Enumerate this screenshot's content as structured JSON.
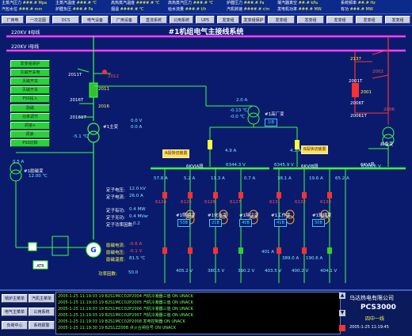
{
  "top_bar": {
    "items": [
      {
        "label": "主蒸汽压力",
        "value": "###.# Mpa"
      },
      {
        "label": "主蒸汽温度",
        "value": "###.# ℃"
      },
      {
        "label": "高热蒸汽温度",
        "value": "####.# ℃"
      },
      {
        "label": "高热蒸汽压力",
        "value": "###.# ℃"
      },
      {
        "label": "炉膛压力",
        "value": "###.# Pa"
      },
      {
        "label": "凝汽器真空",
        "value": "##.# kPa"
      },
      {
        "label": "发电机功率",
        "value": "###.# MW"
      },
      {
        "label": "系统频率",
        "value": "##.# Hz"
      },
      {
        "label": "汽包水位",
        "value": "###.# mm"
      },
      {
        "label": "炉膛负压",
        "value": "###.# Pa"
      },
      {
        "label": "烟温",
        "value": "####.# ℃"
      },
      {
        "label": "给水流量",
        "value": "###.# t/h"
      },
      {
        "label": "汽机转速",
        "value": "####.# r/m"
      },
      {
        "label": "有功",
        "value": "###.# MW"
      }
    ]
  },
  "menu": {
    "items": [
      "厂用电",
      "一次总图",
      "DCS",
      "电气设备",
      "厂用设备",
      "直流系统",
      "公用系统",
      "UPS",
      "发变组",
      "发变组保护",
      "发变组",
      "发变组",
      "发变组",
      "发变组",
      "发变组"
    ]
  },
  "diagram": {
    "title": "#1机组电气主接线系统",
    "bus_ii": "220KV Ⅱ母线",
    "bus_i": "220KV Ⅰ母线",
    "switch_2011T": "2011T",
    "switch_2012": "2012",
    "switch_2011": "2011",
    "switch_2016T": "2016T",
    "switch_2016": "2016",
    "switch_2016_1T": "20161T",
    "switch_2137": "2137",
    "switch_2001T": "2001T",
    "switch_2001": "2001",
    "switch_2002": "2002",
    "switch_2006T": "2006T",
    "switch_2006": "2006",
    "switch_2006_1T": "20061T",
    "qibei": "启备变",
    "main_xfmr": "#1主变",
    "main_xfmr_v": "0.0 V",
    "main_xfmr_a": "0.0 A",
    "main_xfmr_ang": "-5.1 ℃",
    "gao_xfmr": "#1高厂变",
    "gao_v1": "2.0 A",
    "gao_v2": "-0.13 ℃",
    "gao_v3": "-0.0 ℃",
    "gao_tag": "1IB",
    "left_xfmr": "#1励磁变",
    "left_a": "0.5 A",
    "left_b": "12.00 ℃",
    "xfmr_11": "11",
    "xfmr_12": "612",
    "sec_a": "A段快切装置",
    "sec_b": "B段快切装置",
    "bus_6a": "6KVⅠA段",
    "bus_6a_v": "6344.3 V",
    "bus_6b": "6KVⅠB段",
    "bus_6b_v": "6345.9 V",
    "bus_6c": "6KVⅠ段",
    "bus_6c_v": "6366.6 V",
    "i_a": "4.9 A",
    "i_b": "4.2 A",
    "feeders": [
      {
        "a": "57.8 A",
        "name": "6124"
      },
      {
        "a": "5.2 A",
        "name": "6125"
      },
      {
        "a": "11.3 A",
        "name": "6126"
      },
      {
        "a": "0.7 A",
        "name": "6127"
      },
      {
        "a": "38.1 A",
        "name": "6131"
      },
      {
        "a": "19.6 A",
        "name": "6132"
      },
      {
        "a": "65.2 A",
        "name": "6133"
      }
    ],
    "sub_xfmr": [
      {
        "name": "#1照明变",
        "tag": "53B"
      },
      {
        "name": "#1化水变",
        "tag": "21B"
      },
      {
        "name": "#1除尘变",
        "tag": "40B"
      },
      {
        "name": "#1工作变",
        "tag": "41B"
      },
      {
        "name": "#1输煤变",
        "tag": "50B"
      }
    ],
    "low_vals": [
      "405.2 V",
      "380.5 V",
      "390.2 V",
      "403.5 V",
      "400.2 V",
      "404.1 V"
    ],
    "low_a": [
      "401 A",
      "389.0 A",
      "190.6 A"
    ],
    "stator_labels": [
      "定子电压:",
      "定子电流:",
      "定子有功:",
      "定子无功:",
      "定子功率因数:"
    ],
    "stator_vals": [
      "12.0 kV",
      "26.0 A",
      "0.4 MW",
      "0.4 MVar",
      "0.2 "
    ],
    "field_labels": [
      "励磁电流:",
      "励磁电压:",
      "励磁温度:",
      "功率因数:"
    ],
    "field_vals": [
      "-0.6 A",
      "-0.1 V",
      "81.5 ℃",
      "50.0"
    ],
    "gen_label": "G",
    "atr": "ATR",
    "side_buttons": [
      "发变组保护",
      "灭磁开关电",
      "灭磁开关",
      "灭磁开关",
      "PSS投入",
      "励磁",
      "功率调节",
      "调速+",
      "调速-",
      "PSS切除"
    ]
  },
  "footer": {
    "buttons": [
      "锅炉主菜单",
      "汽机主菜单",
      "电气主菜单",
      "公用系统",
      "负荷中心",
      "系统报警"
    ],
    "events": [
      {
        "date": "2005-1-25",
        "time": "11:19:03",
        "id": "19",
        "code": "B2S1MCC02P2004",
        "desc": "汽机冷凝器三值",
        "state": "ON",
        "ack": "UNACK"
      },
      {
        "date": "2005-1-25",
        "time": "11:19:03",
        "id": "19",
        "code": "B2S1MCC02P2005",
        "desc": "汽机冷凝器三值",
        "state": "ON",
        "ack": "UNACK"
      },
      {
        "date": "2005-1-25",
        "time": "11:19:03",
        "id": "19",
        "code": "B2S1MCC02P2006",
        "desc": "汽机冷凝器三值",
        "state": "ON",
        "ack": "UNACK"
      },
      {
        "date": "2005-1-25",
        "time": "11:19:03",
        "id": "19",
        "code": "B2S1MCC02P2007",
        "desc": "汽机冷凝器三值",
        "state": "ON",
        "ack": "UNACK"
      },
      {
        "date": "2005-1-25",
        "time": "11:19:03",
        "id": "19",
        "code": "B2S1MCC02P2008",
        "desc": "发电控制器",
        "state": "ON",
        "ack": "UNACK"
      },
      {
        "date": "2005-1-25",
        "time": "11:19:30",
        "id": "19",
        "code": "B2S1ZZ00B",
        "desc": "点火合闸信号",
        "state": "ON",
        "ack": "UNACK"
      }
    ],
    "company": "乌达热电有限公司",
    "product": "PCS3000",
    "unit": "四中一线",
    "datetime": "2005-1-25  11:19:45"
  },
  "colors": {
    "bg": "#0a1b6e",
    "bus": "#ff40ff",
    "line": "#3cff3c",
    "alarm": "#ff3030",
    "warn": "#ffff40"
  }
}
